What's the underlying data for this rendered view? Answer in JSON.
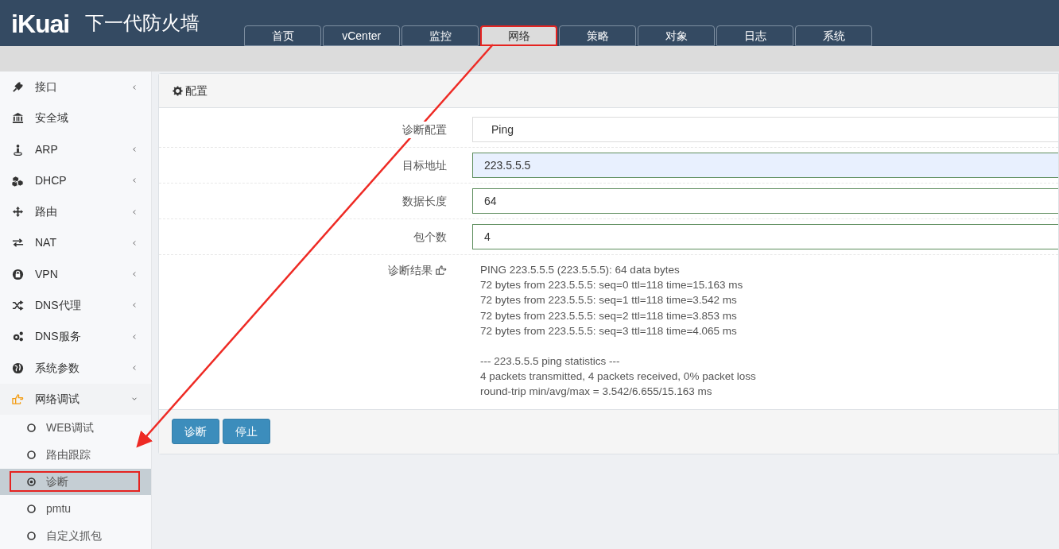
{
  "header": {
    "logo": "iKuai",
    "title": "下一代防火墙"
  },
  "tabs": [
    {
      "label": "首页",
      "selected": false,
      "highlighted": false
    },
    {
      "label": "vCenter",
      "selected": false,
      "highlighted": false
    },
    {
      "label": "监控",
      "selected": false,
      "highlighted": false
    },
    {
      "label": "网络",
      "selected": true,
      "highlighted": true
    },
    {
      "label": "策略",
      "selected": false,
      "highlighted": false
    },
    {
      "label": "对象",
      "selected": false,
      "highlighted": false
    },
    {
      "label": "日志",
      "selected": false,
      "highlighted": false
    },
    {
      "label": "系统",
      "selected": false,
      "highlighted": false
    }
  ],
  "sidebar": {
    "items": [
      {
        "label": "接口",
        "kind": "group",
        "expanded": false
      },
      {
        "label": "安全域",
        "kind": "link"
      },
      {
        "label": "ARP",
        "kind": "group",
        "expanded": false
      },
      {
        "label": "DHCP",
        "kind": "group",
        "expanded": false
      },
      {
        "label": "路由",
        "kind": "group",
        "expanded": false
      },
      {
        "label": "NAT",
        "kind": "group",
        "expanded": false
      },
      {
        "label": "VPN",
        "kind": "group",
        "expanded": false
      },
      {
        "label": "DNS代理",
        "kind": "group",
        "expanded": false
      },
      {
        "label": "DNS服务",
        "kind": "group",
        "expanded": false
      },
      {
        "label": "系统参数",
        "kind": "group",
        "expanded": false
      },
      {
        "label": "网络调试",
        "kind": "group",
        "expanded": true,
        "children": [
          {
            "label": "WEB调试",
            "selected": false,
            "highlighted": false
          },
          {
            "label": "路由跟踪",
            "selected": false,
            "highlighted": false
          },
          {
            "label": "诊断",
            "selected": true,
            "highlighted": true
          },
          {
            "label": "pmtu",
            "selected": false,
            "highlighted": false
          },
          {
            "label": "自定义抓包",
            "selected": false,
            "highlighted": false
          }
        ]
      }
    ]
  },
  "panel": {
    "title": "配置",
    "fields": [
      {
        "label": "诊断配置",
        "kind": "select",
        "value": "Ping",
        "focused": false
      },
      {
        "label": "目标地址",
        "kind": "input",
        "value": "223.5.5.5",
        "focused": true
      },
      {
        "label": "数据长度",
        "kind": "input",
        "value": "64",
        "focused": false
      },
      {
        "label": "包个数",
        "kind": "input",
        "value": "4",
        "focused": false
      }
    ],
    "result": {
      "label": "诊断结果",
      "lines": [
        "PING 223.5.5.5 (223.5.5.5): 64 data bytes",
        "72 bytes from 223.5.5.5: seq=0 ttl=118 time=15.163 ms",
        "72 bytes from 223.5.5.5: seq=1 ttl=118 time=3.542 ms",
        "72 bytes from 223.5.5.5: seq=2 ttl=118 time=3.853 ms",
        "72 bytes from 223.5.5.5: seq=3 ttl=118 time=4.065 ms"
      ],
      "summary": [
        "--- 223.5.5.5 ping statistics ---",
        "4 packets transmitted, 4 packets received, 0% packet loss",
        "round-trip min/avg/max = 3.542/6.655/15.163 ms"
      ]
    },
    "buttons": [
      "诊断",
      "停止"
    ]
  }
}
